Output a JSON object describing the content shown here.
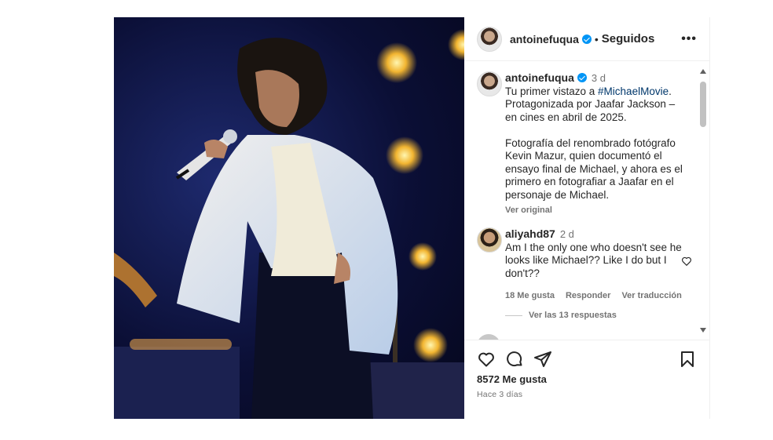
{
  "post": {
    "header": {
      "username": "antoinefuqua",
      "separator": "•",
      "follow_status": "Seguidos",
      "more_label": "•••"
    },
    "caption": {
      "username": "antoinefuqua",
      "time": "3 d",
      "text_before": "Tu primer vistazo a ",
      "hashtag": "#MichaelMovie",
      "text_after": ".\nProtagonizada por Jaafar Jackson – en cines en abril de 2025.\n\nFotografía del renombrado fotógrafo Kevin Mazur, quien documentó el ensayo final de Michael, y ahora es el primero en fotografiar a Jaafar en el personaje de Michael.",
      "see_original": "Ver original"
    },
    "comment": {
      "username": "aliyahd87",
      "time": "2 d",
      "text": "Am I the only one who doesn't see he looks like Michael?? Like I do but I don't??",
      "likes": "18 Me gusta",
      "reply": "Responder",
      "translate": "Ver traducción",
      "view_replies": "Ver las 13 respuestas"
    },
    "actions": {
      "likes": "8572 Me gusta",
      "posted": "Hace 3 días"
    }
  },
  "colors": {
    "verified": "#0095f6",
    "hashtag": "#00376b",
    "secondary_text": "#737373"
  }
}
